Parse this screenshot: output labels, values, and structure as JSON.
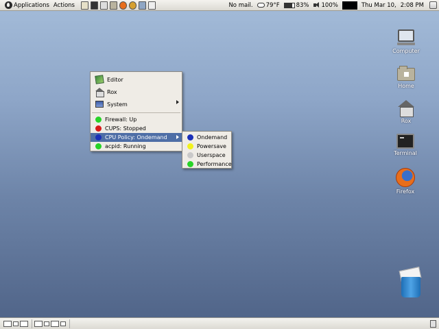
{
  "top_panel": {
    "applications": "Applications",
    "actions": "Actions",
    "launcher_icons": [
      "text-editor-icon",
      "terminal-icon",
      "file-manager-icon",
      "folder-icon",
      "firefox-icon",
      "help-icon",
      "network-icon",
      "screenshot-icon"
    ],
    "mail": "No mail.",
    "temperature": "79°F",
    "battery": "83%",
    "volume": "100%",
    "date": "Thu Mar 10,",
    "time": "2:08 PM"
  },
  "desktop_icons": [
    {
      "label": "Computer",
      "icon": "computer-icon"
    },
    {
      "label": "Home",
      "icon": "home-folder-icon"
    },
    {
      "label": "Rox",
      "icon": "rox-icon"
    },
    {
      "label": "Terminal",
      "icon": "terminal-icon"
    },
    {
      "label": "Firefox",
      "icon": "firefox-icon"
    },
    {
      "label": "",
      "icon": "trash-icon"
    }
  ],
  "main_menu": {
    "apps": [
      {
        "label": "Editor",
        "icon": "editor-icon"
      },
      {
        "label": "Rox",
        "icon": "rox-icon"
      },
      {
        "label": "System",
        "icon": "system-icon",
        "submenu": true
      }
    ],
    "services": [
      {
        "label": "Firewall: Up",
        "status_color": "#27d327"
      },
      {
        "label": "CUPS: Stopped",
        "status_color": "#d81a1a"
      },
      {
        "label": "CPU Policy: Ondemand",
        "status_color": "#1a2fb8",
        "submenu": true,
        "selected": true
      },
      {
        "label": "acpid: Running",
        "status_color": "#27d327"
      }
    ]
  },
  "cpu_submenu": [
    {
      "label": "Ondemand",
      "status_color": "#1a2fb8"
    },
    {
      "label": "Powersave",
      "status_color": "#f2f21c"
    },
    {
      "label": "Userspace",
      "status_color": "#c9c9c9"
    },
    {
      "label": "Performance",
      "status_color": "#27d327"
    }
  ],
  "colors": {
    "selection": "#4e6ea6",
    "desktop_top": "#a4bcd9",
    "desktop_bottom": "#4e6286"
  }
}
